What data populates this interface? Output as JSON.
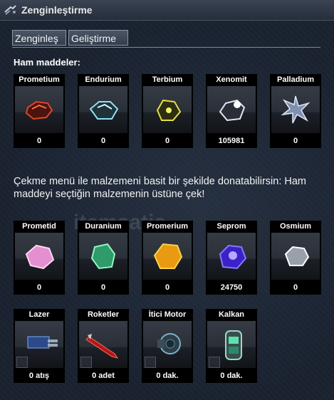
{
  "window": {
    "title": "Zenginleştirme",
    "icon": "refinery-icon"
  },
  "tabs": [
    {
      "label": "Zenginleş"
    },
    {
      "label": "Geliştirme"
    }
  ],
  "raw_section": {
    "title": "Ham maddeler:"
  },
  "raw_materials": [
    {
      "name": "Prometium",
      "value": "0",
      "color": "#d23a1c",
      "icon": "prometium-ore-icon"
    },
    {
      "name": "Endurium",
      "value": "0",
      "color": "#6fc6d6",
      "icon": "endurium-ore-icon"
    },
    {
      "name": "Terbium",
      "value": "0",
      "color": "#d6d23a",
      "icon": "terbium-ore-icon"
    },
    {
      "name": "Xenomit",
      "value": "105981",
      "color": "#dfe6ef",
      "icon": "xenomit-ore-icon"
    },
    {
      "name": "Palladium",
      "value": "0",
      "color": "#b8c6e0",
      "icon": "palladium-crystal-icon"
    }
  ],
  "info_text": "Çekme menü ile malzemeni basit bir şekilde donatabilirsin: Ham maddeyi seçtiğin malzemenin üstüne çek!",
  "refined_materials": [
    {
      "name": "Prometid",
      "value": "0",
      "color": "#f0a4d8",
      "icon": "prometid-icon"
    },
    {
      "name": "Duranium",
      "value": "0",
      "color": "#5fe0a0",
      "icon": "duranium-icon"
    },
    {
      "name": "Promerium",
      "value": "0",
      "color": "#f5b21e",
      "icon": "promerium-icon"
    },
    {
      "name": "Seprom",
      "value": "24750",
      "color": "#5a3cf0",
      "icon": "seprom-icon"
    },
    {
      "name": "Osmium",
      "value": "0",
      "color": "#e8e8ee",
      "icon": "osmium-icon"
    }
  ],
  "equipment": [
    {
      "name": "Lazer",
      "value": "0 atış",
      "icon": "laser-icon"
    },
    {
      "name": "Roketler",
      "value": "0 adet",
      "icon": "rocket-icon"
    },
    {
      "name": "İtici Motor",
      "value": "0 dak.",
      "icon": "thruster-engine-icon"
    },
    {
      "name": "Kalkan",
      "value": "0 dak.",
      "icon": "shield-generator-icon"
    }
  ],
  "watermark": "itemsatis"
}
